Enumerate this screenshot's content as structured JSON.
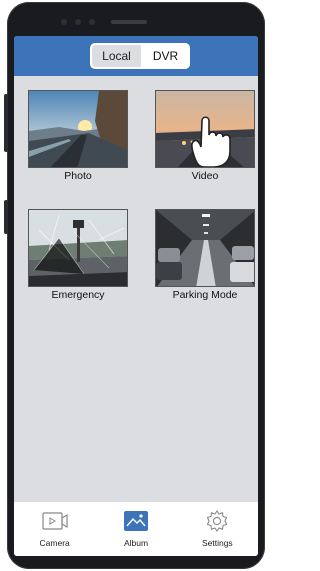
{
  "header": {
    "tabs": [
      {
        "label": "Local",
        "selected": false
      },
      {
        "label": "DVR",
        "selected": true
      }
    ]
  },
  "album": {
    "items": [
      {
        "label": "Photo",
        "icon": "photo-thumbnail"
      },
      {
        "label": "Video",
        "icon": "video-thumbnail"
      },
      {
        "label": "Emergency",
        "icon": "emergency-thumbnail"
      },
      {
        "label": "Parking Mode",
        "icon": "parking-mode-thumbnail"
      }
    ]
  },
  "bottom_nav": {
    "items": [
      {
        "label": "Camera",
        "icon": "camera-icon",
        "active": false
      },
      {
        "label": "Album",
        "icon": "album-icon",
        "active": true
      },
      {
        "label": "Settings",
        "icon": "gear-icon",
        "active": false
      }
    ]
  },
  "colors": {
    "header_blue": "#3d74b9",
    "screen_bg": "#dcdde1",
    "phone_body": "#1a1b1f",
    "active_icon": "#3d74b9"
  }
}
